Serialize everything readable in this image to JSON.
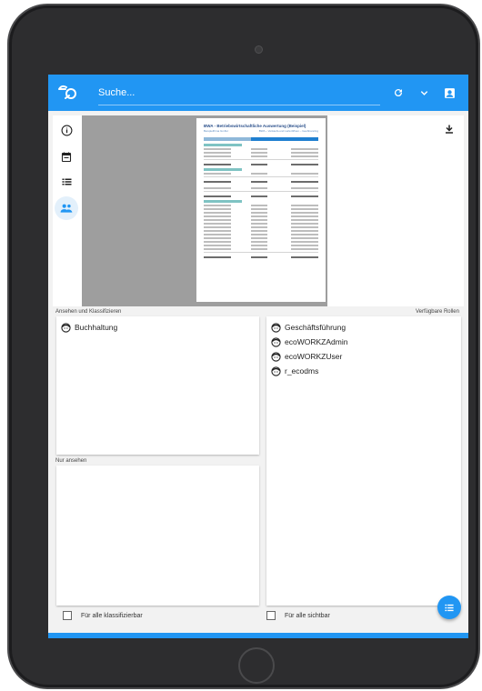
{
  "appbar": {
    "search_placeholder": "Suche...",
    "icons": [
      "refresh-icon",
      "chevron-down-icon",
      "account-box-icon"
    ],
    "color": "#2196f3"
  },
  "preview": {
    "side_icons": [
      "info-icon",
      "calendar-icon",
      "list-icon",
      "people-icon"
    ],
    "active_side_icon": "people-icon",
    "document": {
      "title": "BWA - Betriebswirtschaftliche Auswertung (Beispiel)",
      "company": "Beispielfirma GmbH",
      "subtitle": "BWA – Verkaufs-und Lieferöffnen – Geofinancing"
    },
    "download_icon": "download-icon"
  },
  "roles": {
    "classify_label": "Ansehen und Klassifizieren",
    "available_label": "Verfügbare Rollen",
    "view_only_label": "Nur ansehen",
    "classify_roles": [
      "Buchhaltung"
    ],
    "view_only_roles": [],
    "available_roles": [
      "Geschäftsführung",
      "ecoWORKZAdmin",
      "ecoWORKZUser",
      "r_ecodms"
    ]
  },
  "footer": {
    "classify_all_label": "Für alle klassifizierbar",
    "visible_all_label": "Für alle sichtbar"
  },
  "fab_icon": "list-icon"
}
